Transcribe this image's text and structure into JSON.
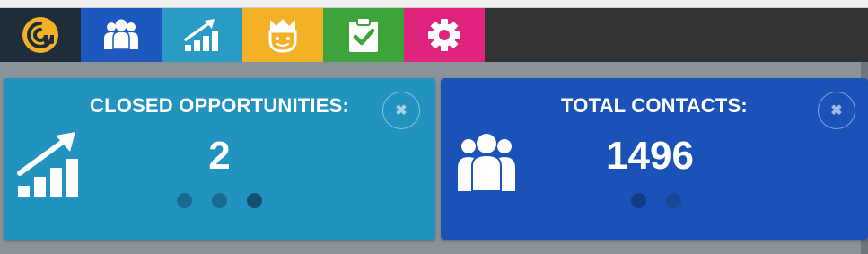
{
  "nav": {
    "tiles": [
      {
        "name": "logo",
        "icon": "spiral-logo-icon",
        "color": "#1f2c3a"
      },
      {
        "name": "contacts",
        "icon": "users-icon",
        "color": "#1c58be"
      },
      {
        "name": "opportunities",
        "icon": "growth-chart-icon",
        "color": "#2a9bc4"
      },
      {
        "name": "leaders",
        "icon": "crown-face-icon",
        "color": "#f3b125"
      },
      {
        "name": "tasks",
        "icon": "clipboard-check-icon",
        "color": "#3ea33a"
      },
      {
        "name": "settings",
        "icon": "gear-icon",
        "color": "#e0237c"
      }
    ]
  },
  "panels": {
    "opportunities": {
      "title": "CLOSED OPPORTUNITIES:",
      "value": "2",
      "close_label": "✖",
      "color": "#2193be",
      "dots": 3,
      "active_dot": 3
    },
    "contacts": {
      "title": "TOTAL CONTACTS:",
      "value": "1496",
      "close_label": "✖",
      "color": "#1b52b8",
      "dots": 2,
      "active_dot": 1
    }
  }
}
